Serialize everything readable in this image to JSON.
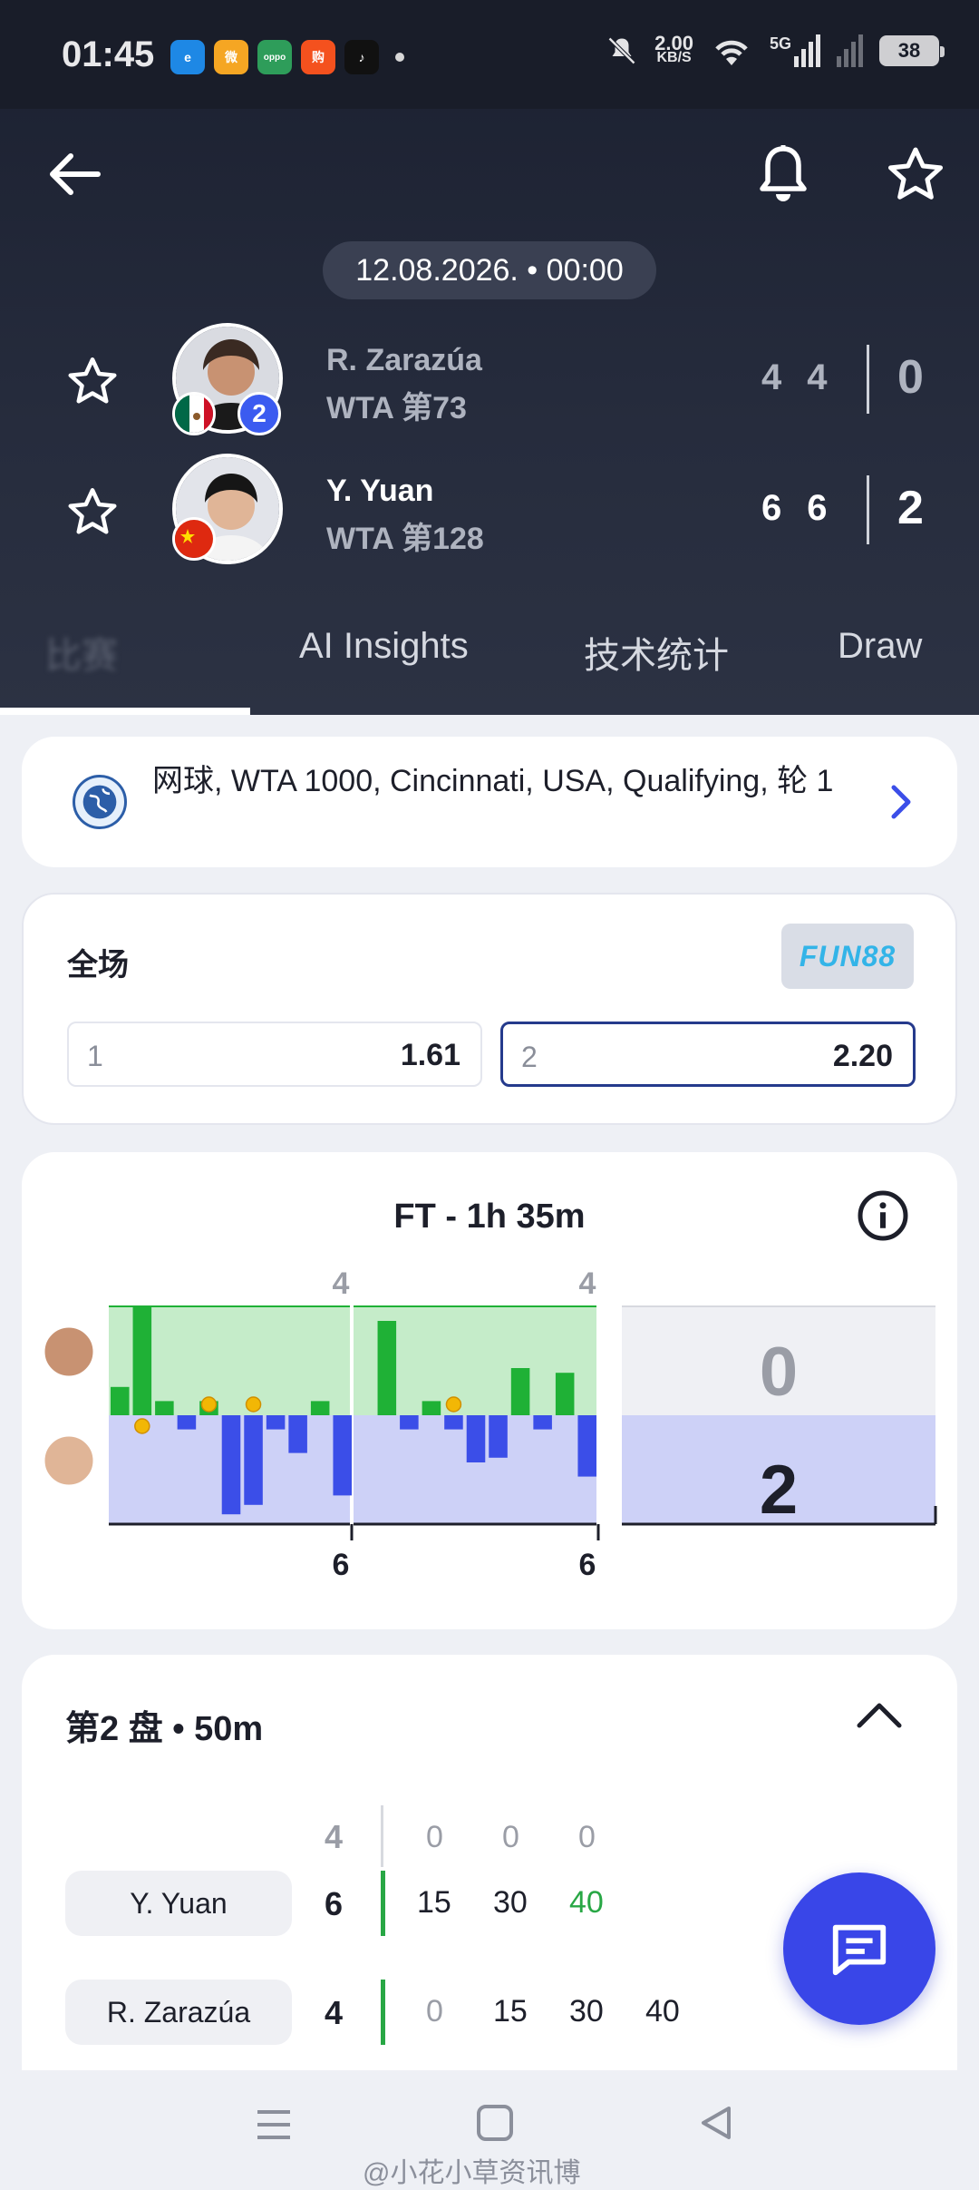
{
  "status_bar": {
    "time": "01:45",
    "apps": [
      {
        "icon": "browser-app-icon",
        "color": "#1e88e5",
        "label": "e"
      },
      {
        "icon": "weibo-app-icon",
        "color": "#f5a623",
        "label": "微"
      },
      {
        "icon": "oppo-app-icon",
        "color": "#2e9d5a",
        "label": "oppo"
      },
      {
        "icon": "store-app-icon",
        "color": "#f4511e",
        "label": "购"
      },
      {
        "icon": "tiktok-app-icon",
        "color": "#111111",
        "label": "♪"
      }
    ],
    "speed_value": "2.00",
    "speed_unit": "KB/S",
    "network": "5G",
    "battery": "38"
  },
  "header": {
    "back_icon": "back-arrow-icon",
    "date_time": "12.08.2026. • 00:00",
    "players": [
      {
        "name": "R. Zarazúa",
        "rank": "WTA 第73",
        "flag": "mexico",
        "seed": "2",
        "sets": [
          "4",
          "4"
        ],
        "total": "0",
        "winner": false
      },
      {
        "name": "Y. Yuan",
        "rank": "WTA 第128",
        "flag": "china",
        "seed": "",
        "sets": [
          "6",
          "6"
        ],
        "total": "2",
        "winner": true
      }
    ]
  },
  "tabs": [
    {
      "label": "比赛",
      "active": true
    },
    {
      "label": "AI Insights",
      "active": false
    },
    {
      "label": "技术统计",
      "active": false
    },
    {
      "label": "Draw",
      "active": false
    }
  ],
  "tournament": {
    "text": "网球, WTA 1000, Cincinnati, USA, Qualifying, 轮 1"
  },
  "odds": {
    "title": "全场",
    "bookmaker": "FUN88",
    "options": [
      {
        "label": "1",
        "value": "1.61",
        "selected": false
      },
      {
        "label": "2",
        "value": "2.20",
        "selected": true
      }
    ]
  },
  "momentum": {
    "title": "FT - 1h 35m",
    "set_top_scores": [
      "4",
      "4"
    ],
    "set_bottom_scores": [
      "6",
      "6"
    ],
    "total_top": "0",
    "total_bottom": "2",
    "colors": {
      "top": "#1fb136",
      "bottom": "#3b4ee8",
      "top_bg": "#c5ecc9",
      "bottom_bg": "#cdd1f7"
    },
    "bars": [
      12,
      46,
      6,
      -6,
      6,
      -42,
      -38,
      -6,
      -16,
      6,
      -34,
      0,
      40,
      -6,
      6,
      -6,
      -20,
      -18,
      20,
      -6,
      18,
      -26
    ],
    "balls": [
      {
        "i": 1,
        "side": "bottom"
      },
      {
        "i": 4,
        "side": "top"
      },
      {
        "i": 6,
        "side": "top"
      },
      {
        "i": 15,
        "side": "top"
      }
    ]
  },
  "set_detail": {
    "title": "第2 盘 • 50m",
    "prev_set_score": "4",
    "header_points": [
      "0",
      "0",
      "0"
    ],
    "rows": [
      {
        "name": "Y. Yuan",
        "set": "6",
        "points": [
          "15",
          "30",
          "40"
        ],
        "last_green": true
      },
      {
        "name": "R. Zarazúa",
        "set": "4",
        "points": [
          "0",
          "15",
          "30",
          "40"
        ],
        "last_green": false
      }
    ]
  },
  "watermark": "@小花小草资讯博"
}
